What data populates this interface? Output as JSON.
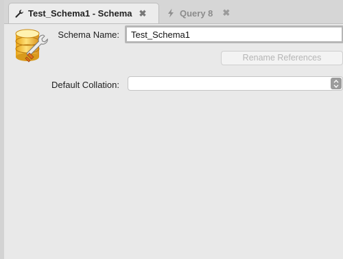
{
  "tabs": [
    {
      "label": "Test_Schema1 - Schema",
      "icon": "wrench-icon",
      "close": "✖"
    },
    {
      "label": "Query 8",
      "icon": "lightning-icon",
      "close": "✖"
    }
  ],
  "form": {
    "schema_name_label": "Schema Name:",
    "schema_name_value": "Test_Schema1",
    "rename_button_label": "Rename References",
    "default_collation_label": "Default Collation:",
    "default_collation_value": ""
  },
  "colors": {
    "tab_active_bg": "#ececec",
    "input_border": "#b6b6b6",
    "disabled_text": "#b5b5b5"
  }
}
